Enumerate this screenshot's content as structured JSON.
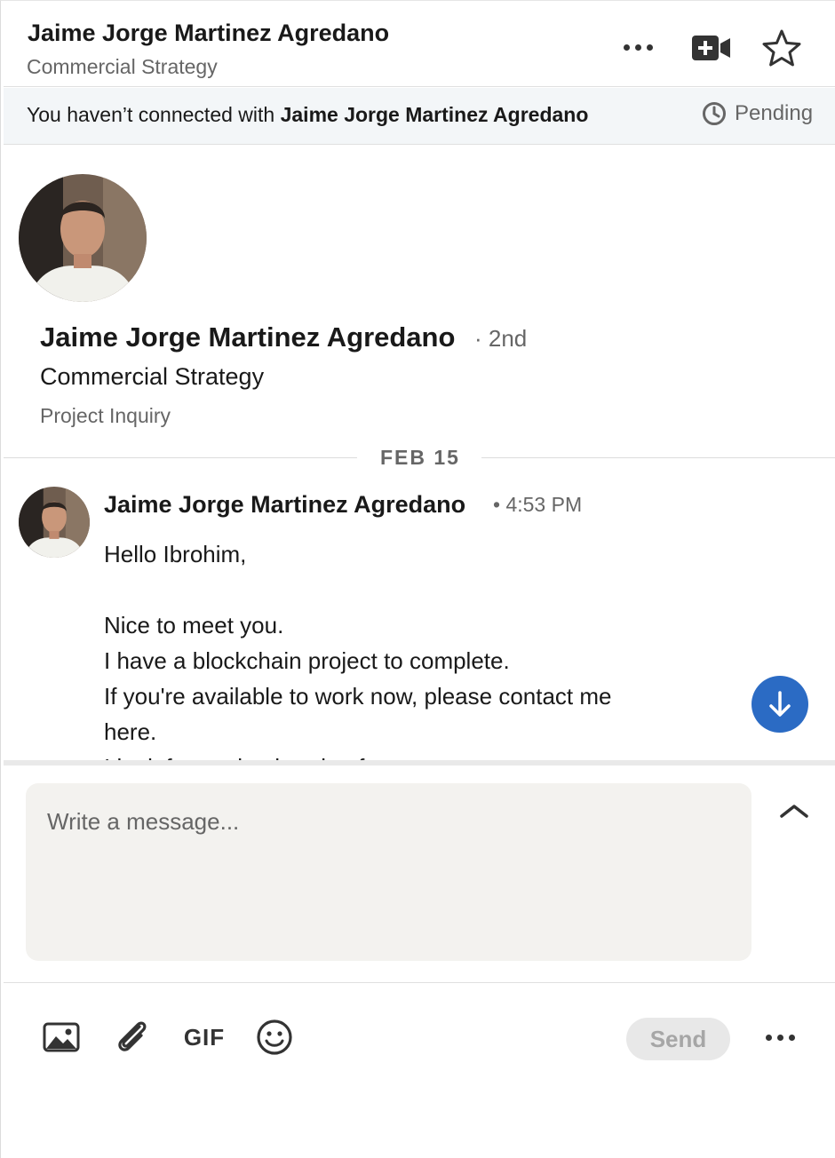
{
  "header": {
    "name": "Jaime Jorge Martinez Agredano",
    "subtitle": "Commercial Strategy",
    "icons": [
      "more-options-icon",
      "video-call-icon",
      "star-icon"
    ]
  },
  "banner": {
    "prefix": "You haven’t connected with ",
    "name": "Jaime Jorge Martinez Agredano",
    "status": "Pending",
    "status_icon": "clock-icon"
  },
  "profile": {
    "name": "Jaime Jorge Martinez Agredano",
    "degree": "· 2nd",
    "title": "Commercial Strategy",
    "subject": "Project Inquiry"
  },
  "date_divider": "FEB 15",
  "message": {
    "sender": "Jaime Jorge Martinez Agredano",
    "time": "• 4:53 PM",
    "lines": [
      "Hello Ibrohim,",
      "",
      "Nice to meet you.",
      "I have a blockchain project to complete.",
      "If you're available to work now, please contact me",
      "here.",
      "I look forward to hearing from you."
    ]
  },
  "composer": {
    "placeholder": "Write a message...",
    "gif_label": "GIF",
    "send_label": "Send"
  },
  "colors": {
    "accent": "#2b6bc4",
    "banner_bg": "#f3f6f8",
    "composer_bg": "#f3f2ef"
  }
}
